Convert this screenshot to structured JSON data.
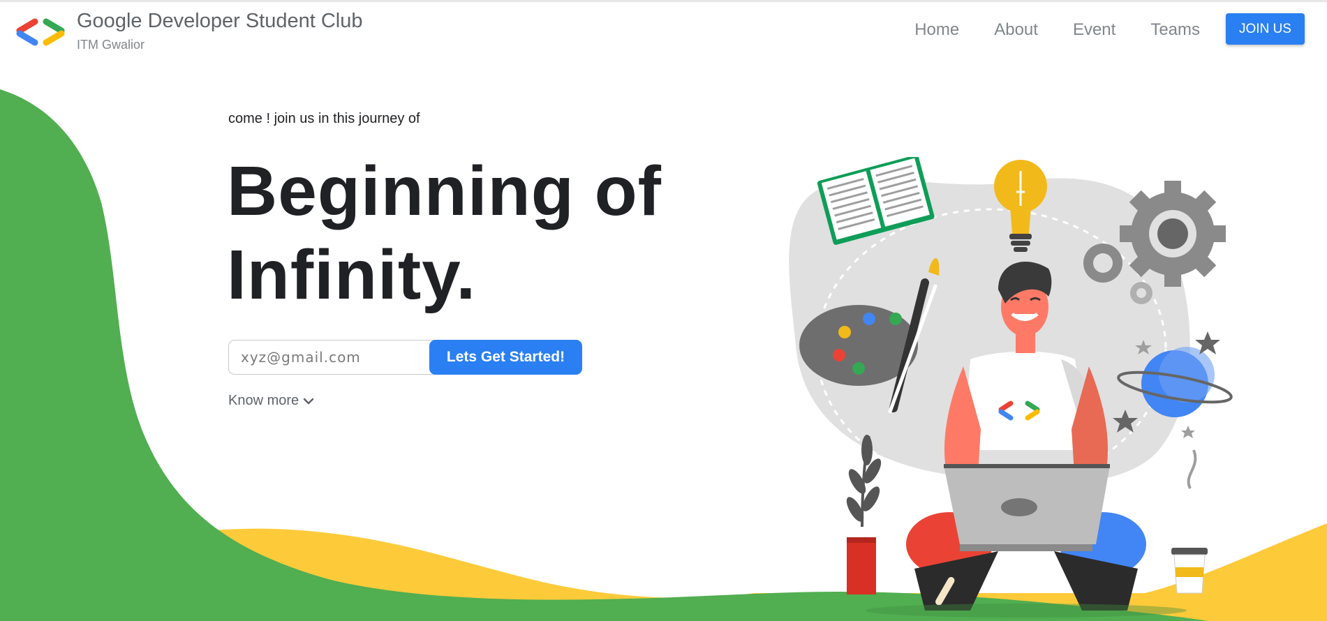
{
  "brand": {
    "title": "Google Developer Student Club",
    "subtitle": "ITM Gwalior",
    "logo_icon": "gdsc-brackets-logo"
  },
  "nav": {
    "links": [
      "Home",
      "About",
      "Event",
      "Teams"
    ],
    "join_label": "JOIN US"
  },
  "hero": {
    "intro": "come ! join us in this journey of",
    "title_line1": "Beginning of",
    "title_line2": "Infinity.",
    "email_placeholder": "xyz@gmail.com",
    "cta_label": "Lets Get Started!",
    "know_more_label": "Know more"
  },
  "colors": {
    "primary_blue": "#2a7ff2",
    "green": "#51ae51",
    "yellow": "#fdca3a",
    "red": "#ea4335"
  }
}
